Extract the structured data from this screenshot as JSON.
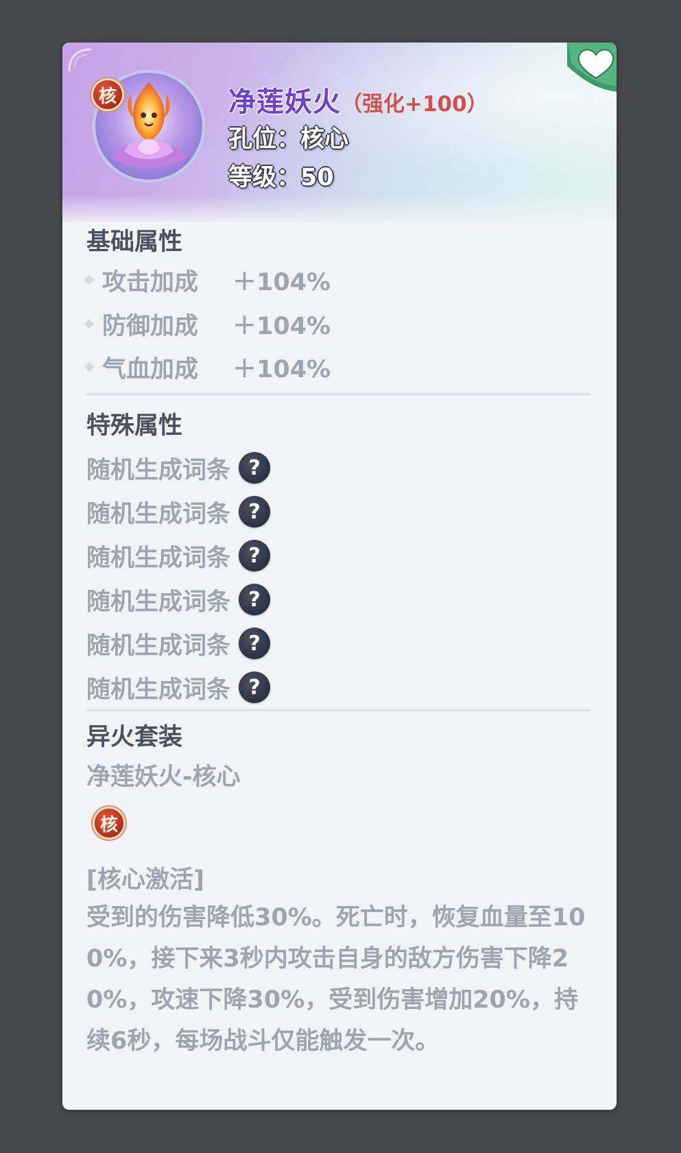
{
  "header": {
    "name": "净莲妖火",
    "enhance": "（强化+100）",
    "slot": "孔位：核心",
    "level": "等级：50",
    "core_badge": "核",
    "favorite_icon": "heart-icon",
    "colors": {
      "name": "#6a42c9",
      "enhance": "#d34e4e"
    }
  },
  "base_attributes": {
    "title": "基础属性",
    "items": [
      {
        "name": "攻击加成",
        "value": "＋104%"
      },
      {
        "name": "防御加成",
        "value": "＋104%"
      },
      {
        "name": "气血加成",
        "value": "＋104%"
      }
    ]
  },
  "special_attributes": {
    "title": "特殊属性",
    "items": [
      {
        "label": "随机生成词条",
        "icon": "?"
      },
      {
        "label": "随机生成词条",
        "icon": "?"
      },
      {
        "label": "随机生成词条",
        "icon": "?"
      },
      {
        "label": "随机生成词条",
        "icon": "?"
      },
      {
        "label": "随机生成词条",
        "icon": "?"
      },
      {
        "label": "随机生成词条",
        "icon": "?"
      }
    ]
  },
  "set": {
    "title": "异火套装",
    "name": "净莲妖火-核心",
    "badge": "核",
    "effect_title": "[核心激活]",
    "effect_text": "受到的伤害降低30%。死亡时，恢复血量至100%，接下来3秒内攻击自身的敌方伤害下降20%，攻速下降30%，受到伤害增加20%，持续6秒，每场战斗仅能触发一次。"
  }
}
